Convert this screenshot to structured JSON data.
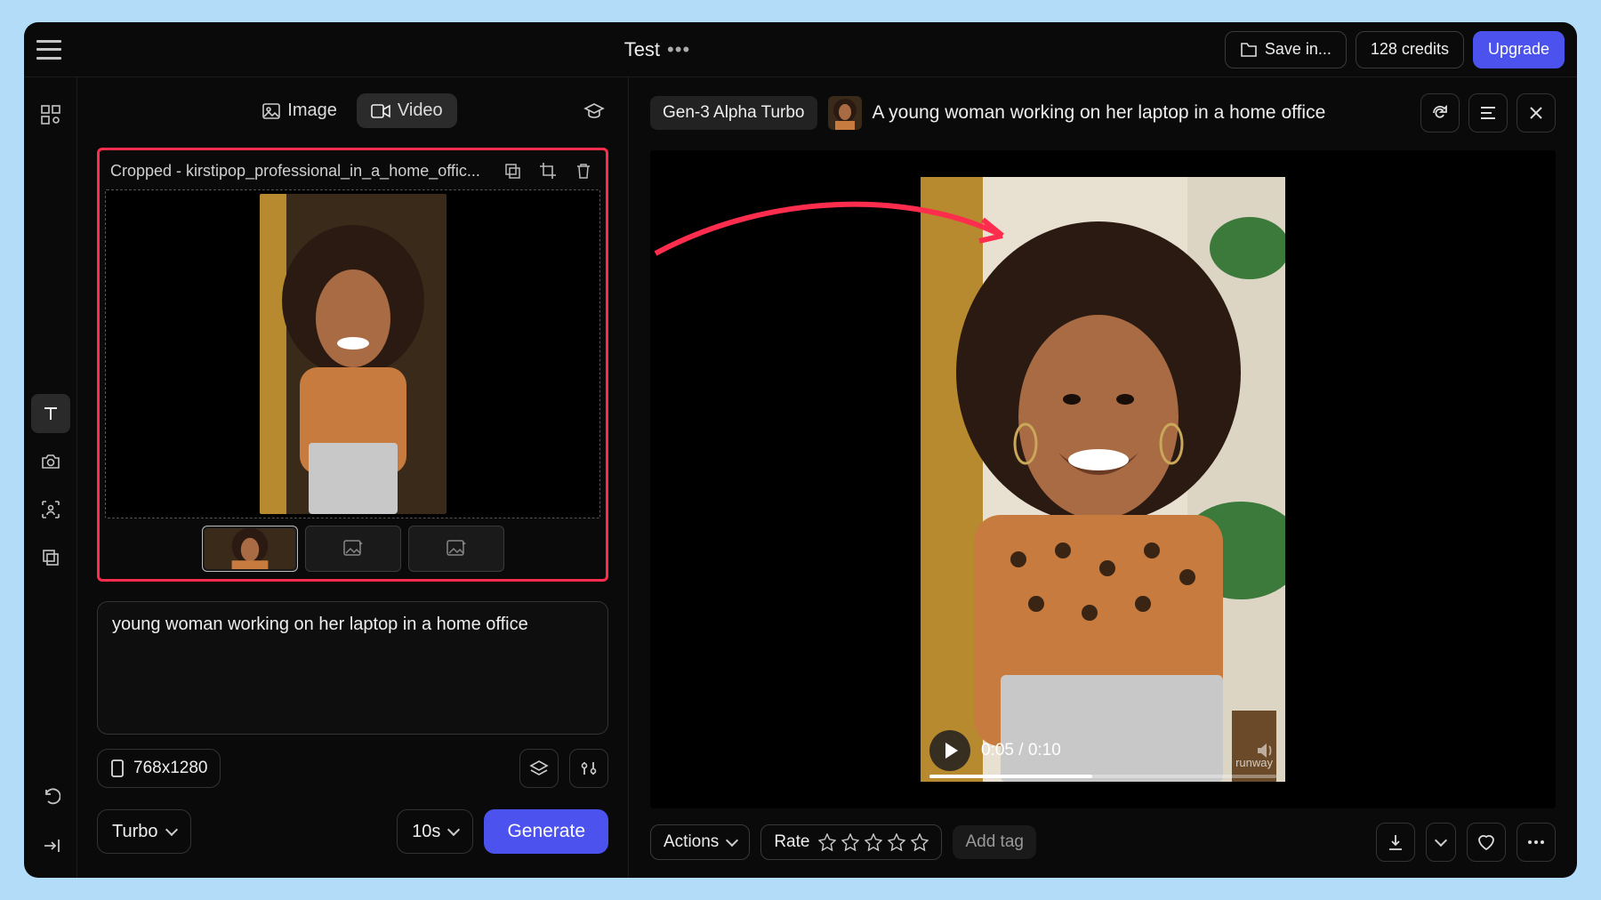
{
  "topbar": {
    "title": "Test",
    "save_label": "Save in...",
    "credits_label": "128 credits",
    "upgrade_label": "Upgrade"
  },
  "tabs": {
    "image": "Image",
    "video": "Video"
  },
  "input_card": {
    "title": "Cropped - kirstipop_professional_in_a_home_offic..."
  },
  "prompt": {
    "text": "young woman working on her laptop in a home office"
  },
  "dimensions": {
    "label": "768x1280"
  },
  "model": {
    "label": "Turbo"
  },
  "duration": {
    "label": "10s"
  },
  "generate": {
    "label": "Generate"
  },
  "result": {
    "model_badge": "Gen-3 Alpha Turbo",
    "prompt_display": "A young woman working on her laptop in a home office",
    "timecode": "0:05 / 0:10",
    "watermark": "runway"
  },
  "footer": {
    "actions_label": "Actions",
    "rate_label": "Rate",
    "add_tag_label": "Add tag"
  }
}
